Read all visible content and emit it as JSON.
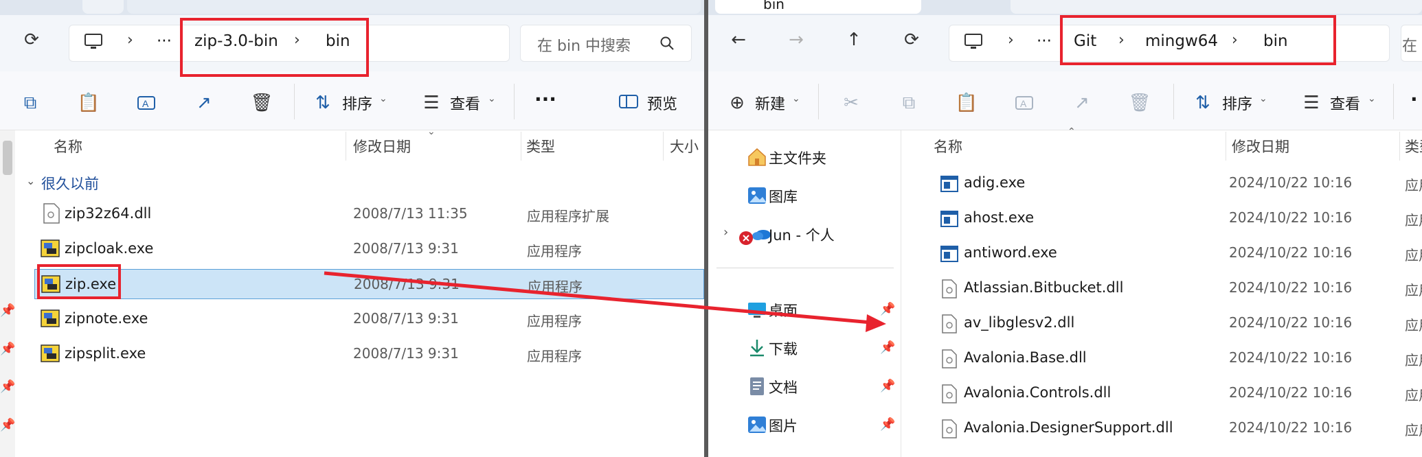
{
  "colors": {
    "accent": "#1f5fa8",
    "annotation": "#e8232e",
    "selection": "#cce4f7"
  },
  "left": {
    "tabs": [
      "",
      ""
    ],
    "breadcrumbs": [
      "zip-3.0-bin",
      "bin"
    ],
    "overflow": "···",
    "search_placeholder": "在 bin 中搜索",
    "toolbar": {
      "sort_label": "排序",
      "view_label": "查看",
      "more_label": "···",
      "preview_label": "预览"
    },
    "columns": [
      "名称",
      "修改日期",
      "类型",
      "大小"
    ],
    "group_label": "很久以前",
    "files": [
      {
        "name": "zip32z64.dll",
        "date": "2008/7/13 11:35",
        "type": "应用程序扩展",
        "icon": "dll-file-icon"
      },
      {
        "name": "zipcloak.exe",
        "date": "2008/7/13 9:31",
        "type": "应用程序",
        "icon": "exe-app-icon"
      },
      {
        "name": "zip.exe",
        "date": "2008/7/13 9:31",
        "type": "应用程序",
        "icon": "exe-app-icon",
        "selected": true
      },
      {
        "name": "zipnote.exe",
        "date": "2008/7/13 9:31",
        "type": "应用程序",
        "icon": "exe-app-icon"
      },
      {
        "name": "zipsplit.exe",
        "date": "2008/7/13 9:31",
        "type": "应用程序",
        "icon": "exe-app-icon"
      }
    ]
  },
  "right": {
    "tabs": [
      "bin",
      ""
    ],
    "breadcrumbs": [
      "Git",
      "mingw64",
      "bin"
    ],
    "overflow": "···",
    "search_placeholder": "在",
    "toolbar": {
      "new_label": "新建",
      "sort_label": "排序",
      "view_label": "查看",
      "more_label": "·"
    },
    "nav": {
      "home": "主文件夹",
      "gallery": "图库",
      "onedrive": "Jun - 个人",
      "desktop": "桌面",
      "downloads": "下载",
      "documents": "文档",
      "pictures": "图片"
    },
    "columns": [
      "名称",
      "修改日期",
      "类型"
    ],
    "files": [
      {
        "name": "adig.exe",
        "date": "2024/10/22 10:16",
        "type": "应用",
        "icon": "exe-window-icon"
      },
      {
        "name": "ahost.exe",
        "date": "2024/10/22 10:16",
        "type": "应用",
        "icon": "exe-window-icon"
      },
      {
        "name": "antiword.exe",
        "date": "2024/10/22 10:16",
        "type": "应用",
        "icon": "exe-window-icon"
      },
      {
        "name": "Atlassian.Bitbucket.dll",
        "date": "2024/10/22 10:16",
        "type": "应用",
        "icon": "dll-file-icon"
      },
      {
        "name": "av_libglesv2.dll",
        "date": "2024/10/22 10:16",
        "type": "应用",
        "icon": "dll-file-icon"
      },
      {
        "name": "Avalonia.Base.dll",
        "date": "2024/10/22 10:16",
        "type": "应用",
        "icon": "dll-file-icon"
      },
      {
        "name": "Avalonia.Controls.dll",
        "date": "2024/10/22 10:16",
        "type": "应用",
        "icon": "dll-file-icon"
      },
      {
        "name": "Avalonia.DesignerSupport.dll",
        "date": "2024/10/22 10:16",
        "type": "应用",
        "icon": "dll-file-icon"
      }
    ]
  }
}
